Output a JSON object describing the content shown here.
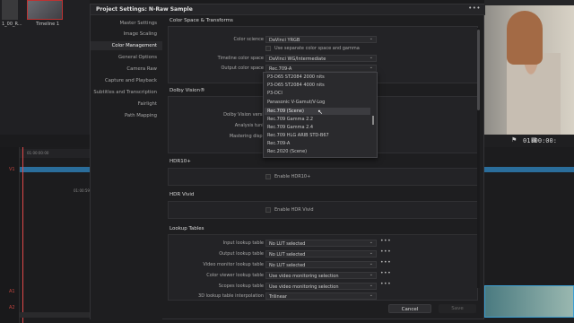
{
  "background": {
    "thumb1_label": "1_00_R...",
    "thumb2_label": "Timeline 1",
    "viewer_timecode": "01:00:00:",
    "timeline_timecode_1": "01:00:00:00",
    "timeline_timecode_2": "01:00:59:00",
    "track_labels": [
      "V1",
      "A1",
      "A2"
    ]
  },
  "dialog": {
    "title": "Project Settings:  N-Raw Sample",
    "menu_dots": "•••",
    "sidebar": [
      {
        "label": "Master Settings",
        "active": false
      },
      {
        "label": "Image Scaling",
        "active": false
      },
      {
        "label": "Color Management",
        "active": true
      },
      {
        "label": "General Options",
        "active": false
      },
      {
        "label": "Camera Raw",
        "active": false
      },
      {
        "label": "Capture and Playback",
        "active": false
      },
      {
        "label": "Subtitles and Transcription",
        "active": false
      },
      {
        "label": "Fairlight",
        "active": false
      },
      {
        "label": "Path Mapping",
        "active": false
      }
    ],
    "color_space": {
      "title": "Color Space & Transforms",
      "color_science_label": "Color science",
      "color_science_value": "DaVinci YRGB",
      "separate_gamma_label": "Use separate color space and gamma",
      "timeline_cs_label": "Timeline color space",
      "timeline_cs_value": "DaVinci WG/Intermediate",
      "output_cs_label": "Output color space",
      "output_cs_value": "Rec.709-A"
    },
    "popup": {
      "items": [
        "P3-D65 ST2084 2000 nits",
        "P3-D65 ST2084 4000 nits",
        "P3-DCI",
        "Panasonic V-Gamut/V-Log",
        "Rec.709 (Scene)",
        "Rec.709 Gamma 2.2",
        "Rec.709 Gamma 2.4",
        "Rec.709 HLG ARIB STD-B67",
        "Rec.709-A",
        "Rec.2020 (Scene)"
      ],
      "highlighted_index": 4
    },
    "dolby": {
      "title": "Dolby Vision®",
      "version_label": "Dolby Vision version",
      "analysis_label": "Analysis tuning",
      "mastering_label": "Mastering display"
    },
    "hdr10": {
      "title": "HDR10+",
      "enable_label": "Enable HDR10+"
    },
    "hdr_vivid": {
      "title": "HDR Vivid",
      "enable_label": "Enable HDR Vivid"
    },
    "lut": {
      "title": "Lookup Tables",
      "rows": [
        {
          "label": "Input lookup table",
          "value": "No LUT selected"
        },
        {
          "label": "Output lookup table",
          "value": "No LUT selected"
        },
        {
          "label": "Video monitor lookup table",
          "value": "No LUT selected"
        },
        {
          "label": "Color viewer lookup table",
          "value": "Use video monitoring selection"
        },
        {
          "label": "Scopes lookup table",
          "value": "Use video monitoring selection"
        },
        {
          "label": "3D lookup table interpolation",
          "value": "Trilinear"
        }
      ],
      "more": "•••"
    },
    "buttons": {
      "cancel": "Cancel",
      "save": "Save"
    }
  }
}
